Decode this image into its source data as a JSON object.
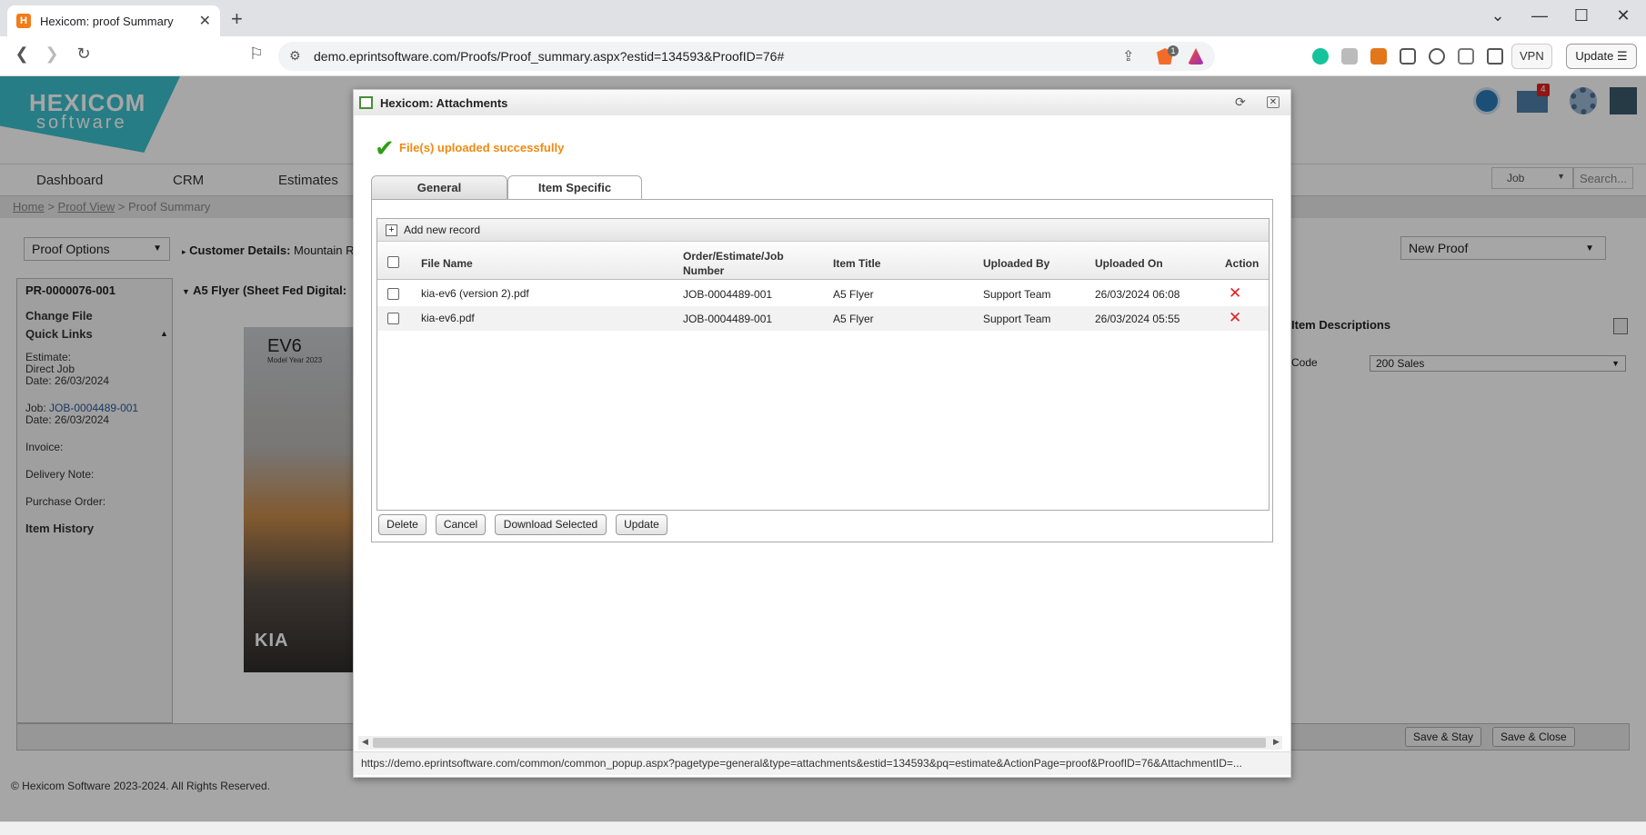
{
  "browser": {
    "tab_title": "Hexicom: proof Summary",
    "favicon_letter": "H",
    "url": "demo.eprintsoftware.com/Proofs/Proof_summary.aspx?estid=134593&ProofID=76#",
    "vpn_label": "VPN",
    "update_label": "Update",
    "extension_badge": "1"
  },
  "logo": {
    "line1": "HEXICOM",
    "line2": "software"
  },
  "header": {
    "notification_count": "4"
  },
  "nav": {
    "items": [
      "Dashboard",
      "CRM",
      "Estimates"
    ],
    "search_type": "Job",
    "search_placeholder": "Search..."
  },
  "breadcrumb": {
    "home": "Home",
    "proof_view": "Proof View",
    "current": "Proof Summary",
    "separator": ">"
  },
  "toolbar": {
    "proof_options": "Proof Options",
    "customer_label": "Customer Details:",
    "customer_value": "Mountain R",
    "new_proof": "New Proof"
  },
  "left_panel": {
    "proof_number": "PR-0000076-001",
    "item_heading": "A5 Flyer (Sheet Fed Digital:",
    "change_file": "Change File",
    "quick_links": "Quick Links",
    "estimate_label": "Estimate:",
    "estimate_value": "Direct Job",
    "estimate_date": "Date: 26/03/2024",
    "job_label": "Job:",
    "job_value": "JOB-0004489-001",
    "job_date": "Date: 26/03/2024",
    "invoice": "Invoice:",
    "delivery_note": "Delivery Note:",
    "purchase_order": "Purchase Order:",
    "item_history": "Item History"
  },
  "proof_image": {
    "title": "EV6",
    "subtitle": "Model Year 2023",
    "brand": "KIA"
  },
  "right_panel": {
    "item_descriptions": "Item Descriptions",
    "code_label": "Code",
    "code_value": "200 Sales"
  },
  "footer": {
    "save_stay": "Save & Stay",
    "save_close": "Save & Close",
    "copyright": "© Hexicom Software 2023-2024. All Rights Reserved."
  },
  "modal": {
    "title": "Hexicom: Attachments",
    "success_message": "File(s) uploaded successfully",
    "tabs": [
      {
        "label": "General",
        "active": false
      },
      {
        "label": "Item Specific",
        "active": true
      }
    ],
    "add_record": "Add new record",
    "columns": [
      "File Name",
      "Order/Estimate/Job Number",
      "Item Title",
      "Uploaded By",
      "Uploaded On",
      "Action"
    ],
    "rows": [
      {
        "file_name": "kia-ev6 (version 2).pdf",
        "number": "JOB-0004489-001",
        "item_title": "A5 Flyer",
        "uploaded_by": "Support Team",
        "uploaded_on": "26/03/2024 06:08"
      },
      {
        "file_name": "kia-ev6.pdf",
        "number": "JOB-0004489-001",
        "item_title": "A5 Flyer",
        "uploaded_by": "Support Team",
        "uploaded_on": "26/03/2024 05:55"
      }
    ],
    "buttons": {
      "delete": "Delete",
      "cancel": "Cancel",
      "download_selected": "Download Selected",
      "update": "Update"
    },
    "status_url": "https://demo.eprintsoftware.com/common/common_popup.aspx?pagetype=general&type=attachments&estid=134593&pq=estimate&ActionPage=proof&ProofID=76&AttachmentID=..."
  },
  "colors": {
    "success_text": "#f08a10",
    "success_icon": "#2e9e17",
    "delete_icon": "#e02020",
    "logo_bg": "#3cc0cc"
  },
  "icons": [
    "favicon-icon",
    "close-icon",
    "new-tab-icon",
    "minimize-icon",
    "maximize-icon",
    "window-close-icon",
    "back-icon",
    "forward-icon",
    "reload-icon",
    "bookmark-icon",
    "site-info-icon",
    "share-icon",
    "brave-shield-icon",
    "brave-rewards-icon",
    "grammarly-icon",
    "extension-icon",
    "metamask-icon",
    "wallet-icon",
    "search-lens-icon",
    "puzzle-icon",
    "menu-icon",
    "checkmark-icon",
    "refresh-icon",
    "add-icon",
    "delete-icon"
  ]
}
